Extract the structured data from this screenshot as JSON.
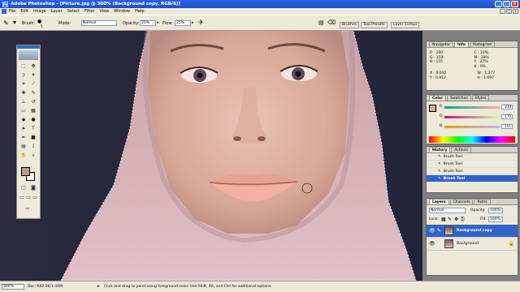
{
  "window": {
    "title": "Adobe Photoshop - [Picture.jpg @ 300% (Background copy, RGB/8)]",
    "controls": [
      "_",
      "□",
      "×"
    ]
  },
  "menubar": {
    "items": [
      "File",
      "Edit",
      "Image",
      "Layer",
      "Select",
      "Filter",
      "View",
      "Window",
      "Help"
    ],
    "controls": [
      "_",
      "□",
      "×"
    ]
  },
  "options": {
    "brush_label": "Brush:",
    "brush_size": "5",
    "mode_label": "Mode:",
    "mode_value": "Normal",
    "opacity_label": "Opacity:",
    "opacity_value": "25%",
    "flow_label": "Flow:",
    "flow_value": "25%",
    "palette_tabs": [
      "Brushes",
      "Tool Presets",
      "Layer Comps"
    ]
  },
  "info_panel": {
    "tabs": [
      "Navigator",
      "Info",
      "Histogram"
    ],
    "active_tab": "Info",
    "rgb": [
      {
        "label": "R :",
        "value": "200"
      },
      {
        "label": "G :",
        "value": "153"
      },
      {
        "label": "B :",
        "value": "155"
      }
    ],
    "cmyk": [
      {
        "label": "C :",
        "value": "23%"
      },
      {
        "label": "M :",
        "value": "39%"
      },
      {
        "label": "Y :",
        "value": "27%"
      },
      {
        "label": "K :",
        "value": "0%"
      }
    ],
    "coords": [
      {
        "label": "X :",
        "value": "0.032"
      },
      {
        "label": "Y :",
        "value": "0.912"
      }
    ],
    "size": [
      {
        "label": "W :",
        "value": "1.377"
      },
      {
        "label": "H :",
        "value": "1.697"
      }
    ]
  },
  "color_panel": {
    "tabs": [
      "Color",
      "Swatches",
      "Styles"
    ],
    "active_tab": "Color",
    "channels": [
      {
        "label": "R",
        "value": "210",
        "fraction": 0.82
      },
      {
        "label": "G",
        "value": "170",
        "fraction": 0.67
      },
      {
        "label": "B",
        "value": "151",
        "fraction": 0.59
      }
    ],
    "foreground": "#d2aa97"
  },
  "history_panel": {
    "tabs": [
      "History",
      "Actions"
    ],
    "active_tab": "History",
    "items": [
      "Brush Tool",
      "Brush Tool",
      "Brush Tool",
      "Brush Tool"
    ],
    "selected_index": 3
  },
  "layers_panel": {
    "tabs": [
      "Layers",
      "Channels",
      "Paths"
    ],
    "active_tab": "Layers",
    "blend_mode": "Normal",
    "opacity_label": "Opacity:",
    "opacity_value": "100%",
    "lock_label": "Lock:",
    "fill_label": "Fill:",
    "fill_value": "100%",
    "layers": [
      {
        "name": "Background copy",
        "selected": true
      },
      {
        "name": "Background",
        "selected": false
      }
    ]
  },
  "statusbar": {
    "zoom": "300%",
    "doc": "Doc: 642.0K/1.44M",
    "hint": "Click and drag to paint using foreground color.  Use Shift, Alt, and Ctrl for additional options."
  },
  "colors": {
    "title_blue": "#1f4fc4",
    "selection_blue": "#3164c8",
    "panel_bg": "#ece9d8",
    "foreground_swatch": "#c49784"
  }
}
